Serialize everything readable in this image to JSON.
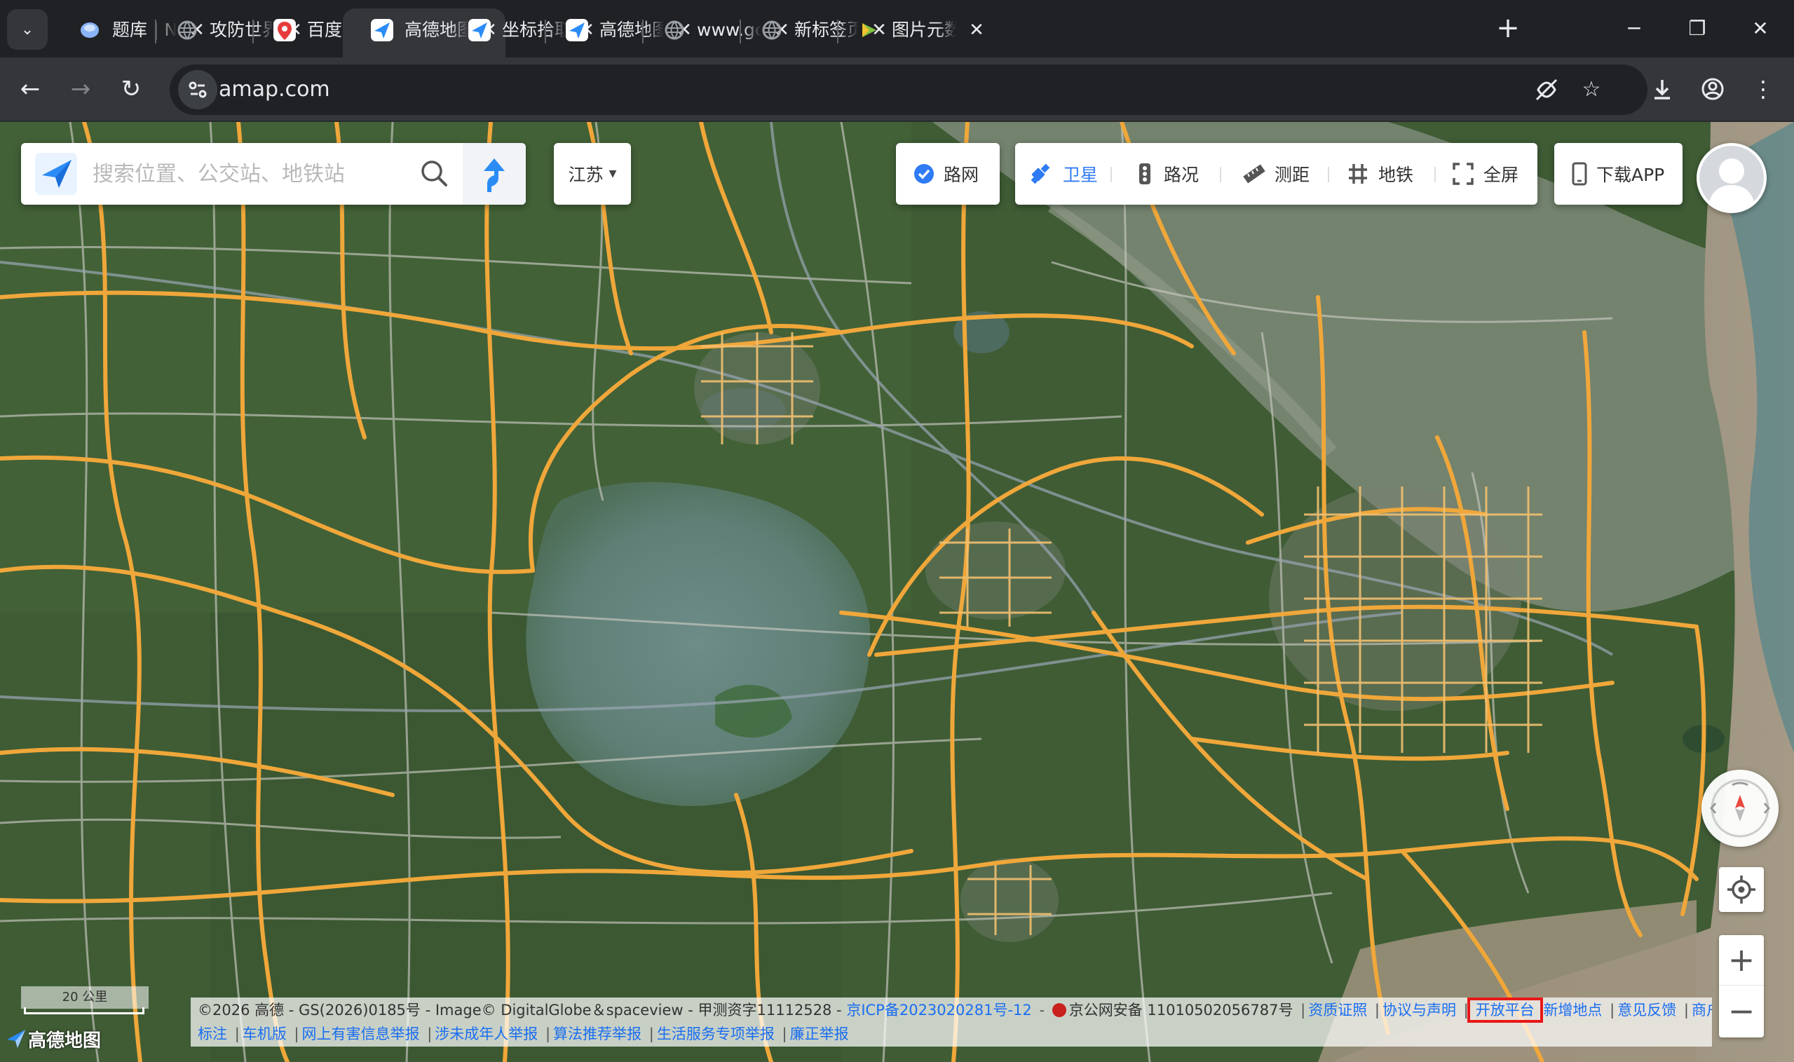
{
  "browser": {
    "tabs": [
      {
        "title": "题库 | N",
        "fav": "tiku-icon",
        "color": "#8ab4f8"
      },
      {
        "title": "攻防世界",
        "fav": "globe-icon",
        "color": "#9aa0a6"
      },
      {
        "title": "百度地图",
        "fav": "baidu-map-pin-icon",
        "color": "#e63c3c"
      },
      {
        "title": "高德地图",
        "fav": "amap-icon",
        "color": "#2b8cf5",
        "active": true
      },
      {
        "title": "坐标拾取",
        "fav": "amap-icon",
        "color": "#2b8cf5"
      },
      {
        "title": "高德地图",
        "fav": "amap-icon",
        "color": "#2b8cf5"
      },
      {
        "title": "www.gc",
        "fav": "globe-icon",
        "color": "#9aa0a6"
      },
      {
        "title": "新标签页",
        "fav": "globe-icon",
        "color": "#9aa0a6"
      },
      {
        "title": "图片元数据",
        "fav": "image-meta-icon",
        "color": "#7fc241"
      }
    ],
    "url": "amap.com"
  },
  "map": {
    "search_placeholder": "搜索位置、公交站、地铁站",
    "city": "江苏",
    "roadnet_label": "路网",
    "tools": {
      "satellite": "卫星",
      "traffic": "路况",
      "measure": "测距",
      "subway": "地铁",
      "fullscreen": "全屏"
    },
    "download_label": "下载APP",
    "scale_label": "20 公里",
    "brand": "高德地图",
    "layer": "satellite",
    "colors": {
      "accent": "#2f7bf5",
      "road": "#f0a73a",
      "highlight": "#e81818"
    }
  },
  "footer": {
    "copyright": "©2026 高德 - GS(2026)0185号 - Image© DigitalGlobe＆spaceview - 甲测资字11112528 -",
    "icp": "京ICP备2023020281号-12",
    "police": "京公网安备 11010502056787号",
    "links_row1": [
      "资质证照",
      "协议与声明",
      "开放平台",
      "新增地点",
      "意见反馈",
      "商户免费"
    ],
    "links_row2": [
      "标注",
      "车机版",
      "网上有害信息举报",
      "涉未成年人举报",
      "算法推荐举报",
      "生活服务专项举报",
      "廉正举报"
    ],
    "highlighted": "开放平台"
  }
}
